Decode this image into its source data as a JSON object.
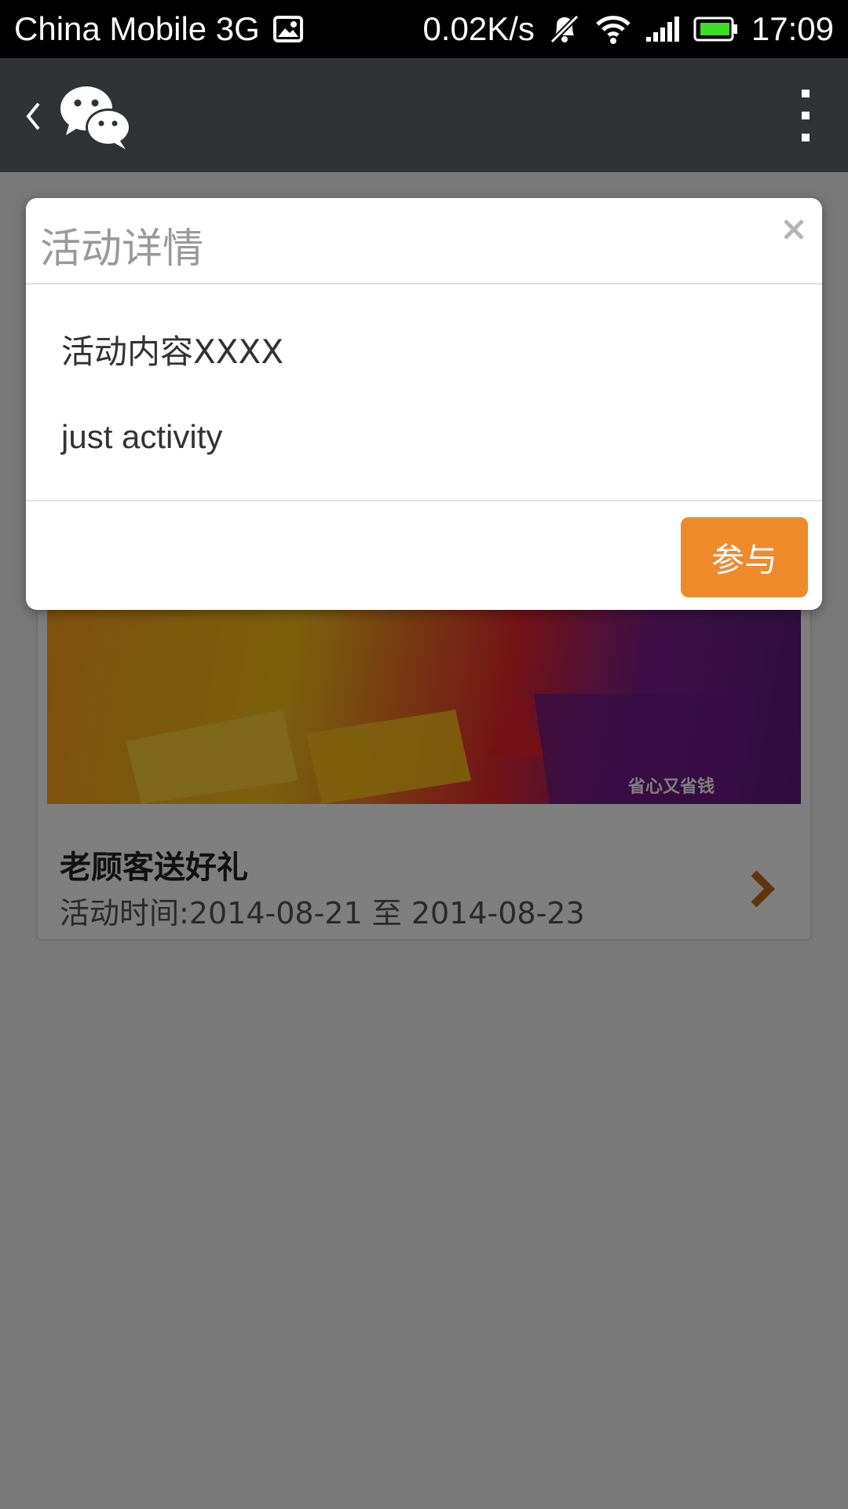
{
  "status_bar": {
    "carrier": "China Mobile 3G",
    "network_speed": "0.02K/s",
    "time": "17:09",
    "icons": [
      "image-icon",
      "mute-icon",
      "wifi-icon",
      "signal-icon",
      "battery-icon"
    ],
    "battery_color": "#3cdc2a"
  },
  "app_bar": {
    "background": "#2f3336",
    "icons": [
      "back-icon",
      "wechat-logo",
      "more-icon"
    ]
  },
  "activity": {
    "banner_slogan": "省心又省钱",
    "title": "老顾客送好礼",
    "time": "活动时间:2014-08-21 至 2014-08-23",
    "arrow_color": "#c76a1a"
  },
  "modal": {
    "title": "活动详情",
    "content_lines": [
      "活动内容XXXX",
      "just activity"
    ],
    "join_label": "参与",
    "accent_color": "#ef8a2b"
  }
}
